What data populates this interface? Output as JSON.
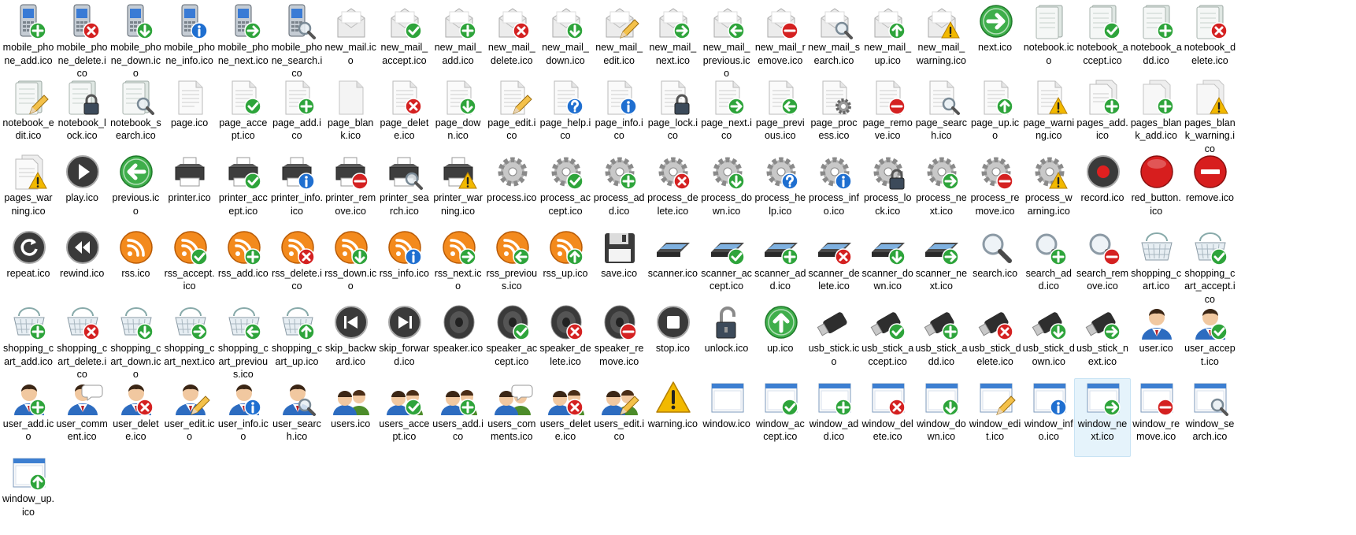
{
  "colors": {
    "accept": "#2ea43b",
    "add": "#2ea43b",
    "delete": "#d42121",
    "remove": "#d42121",
    "down": "#2ea43b",
    "up": "#2ea43b",
    "next": "#2ea43b",
    "previous": "#2ea43b",
    "info": "#1f6fd0",
    "help": "#1f6fd0",
    "warning": "#f2b900",
    "selection": "#e5f3fb"
  },
  "selected_file": "window_next.ico",
  "files": [
    {
      "name": "mobile_phone_add.ico",
      "icon": "mobile-phone-icon",
      "badge": "add"
    },
    {
      "name": "mobile_phone_delete.ico",
      "icon": "mobile-phone-icon",
      "badge": "delete"
    },
    {
      "name": "mobile_phone_down.ico",
      "icon": "mobile-phone-icon",
      "badge": "down"
    },
    {
      "name": "mobile_phone_info.ico",
      "icon": "mobile-phone-icon",
      "badge": "info"
    },
    {
      "name": "mobile_phone_next.ico",
      "icon": "mobile-phone-icon",
      "badge": "next"
    },
    {
      "name": "mobile_phone_search.ico",
      "icon": "mobile-phone-icon",
      "badge": "search"
    },
    {
      "name": "new_mail.ico",
      "icon": "mail-icon",
      "badge": ""
    },
    {
      "name": "new_mail_accept.ico",
      "icon": "mail-icon",
      "badge": "accept"
    },
    {
      "name": "new_mail_add.ico",
      "icon": "mail-icon",
      "badge": "add"
    },
    {
      "name": "new_mail_delete.ico",
      "icon": "mail-icon",
      "badge": "delete"
    },
    {
      "name": "new_mail_down.ico",
      "icon": "mail-icon",
      "badge": "down"
    },
    {
      "name": "new_mail_edit.ico",
      "icon": "mail-icon",
      "badge": "edit"
    },
    {
      "name": "new_mail_next.ico",
      "icon": "mail-icon",
      "badge": "next"
    },
    {
      "name": "new_mail_previous.ico",
      "icon": "mail-icon",
      "badge": "previous"
    },
    {
      "name": "new_mail_remove.ico",
      "icon": "mail-icon",
      "badge": "remove"
    },
    {
      "name": "new_mail_search.ico",
      "icon": "mail-icon",
      "badge": "search"
    },
    {
      "name": "new_mail_up.ico",
      "icon": "mail-icon",
      "badge": "up"
    },
    {
      "name": "new_mail_warning.ico",
      "icon": "mail-icon",
      "badge": "warning"
    },
    {
      "name": "next.ico",
      "icon": "next-arrow-icon",
      "badge": ""
    },
    {
      "name": "notebook.ico",
      "icon": "notebook-icon",
      "badge": ""
    },
    {
      "name": "notebook_accept.ico",
      "icon": "notebook-icon",
      "badge": "accept"
    },
    {
      "name": "notebook_add.ico",
      "icon": "notebook-icon",
      "badge": "add"
    },
    {
      "name": "notebook_delete.ico",
      "icon": "notebook-icon",
      "badge": "delete"
    },
    {
      "name": "notebook_edit.ico",
      "icon": "notebook-icon",
      "badge": "edit"
    },
    {
      "name": "notebook_lock.ico",
      "icon": "notebook-icon",
      "badge": "lock"
    },
    {
      "name": "notebook_search.ico",
      "icon": "notebook-icon",
      "badge": "search"
    },
    {
      "name": "page.ico",
      "icon": "page-icon",
      "badge": ""
    },
    {
      "name": "page_accept.ico",
      "icon": "page-icon",
      "badge": "accept"
    },
    {
      "name": "page_add.ico",
      "icon": "page-icon",
      "badge": "add"
    },
    {
      "name": "page_blank.ico",
      "icon": "blank-page-icon",
      "badge": ""
    },
    {
      "name": "page_delete.ico",
      "icon": "page-icon",
      "badge": "delete"
    },
    {
      "name": "page_down.ico",
      "icon": "page-icon",
      "badge": "down"
    },
    {
      "name": "page_edit.ico",
      "icon": "page-icon",
      "badge": "edit"
    },
    {
      "name": "page_help.ico",
      "icon": "page-icon",
      "badge": "help"
    },
    {
      "name": "page_info.ico",
      "icon": "page-icon",
      "badge": "info"
    },
    {
      "name": "page_lock.ico",
      "icon": "page-icon",
      "badge": "lock"
    },
    {
      "name": "page_next.ico",
      "icon": "page-icon",
      "badge": "next"
    },
    {
      "name": "page_previous.ico",
      "icon": "page-icon",
      "badge": "previous"
    },
    {
      "name": "page_process.ico",
      "icon": "page-icon",
      "badge": "gear"
    },
    {
      "name": "page_remove.ico",
      "icon": "page-icon",
      "badge": "remove"
    },
    {
      "name": "page_search.ico",
      "icon": "page-icon",
      "badge": "search"
    },
    {
      "name": "page_up.ico",
      "icon": "page-icon",
      "badge": "up"
    },
    {
      "name": "page_warning.ico",
      "icon": "page-icon",
      "badge": "warning"
    },
    {
      "name": "pages_add.ico",
      "icon": "pages-icon",
      "badge": "add"
    },
    {
      "name": "pages_blank_add.ico",
      "icon": "blank-pages-icon",
      "badge": "add"
    },
    {
      "name": "pages_blank_warning.ico",
      "icon": "blank-pages-icon",
      "badge": "warning"
    },
    {
      "name": "pages_warning.ico",
      "icon": "pages-icon",
      "badge": "warning"
    },
    {
      "name": "play.ico",
      "icon": "play-icon",
      "badge": ""
    },
    {
      "name": "previous.ico",
      "icon": "previous-arrow-icon",
      "badge": ""
    },
    {
      "name": "printer.ico",
      "icon": "printer-icon",
      "badge": ""
    },
    {
      "name": "printer_accept.ico",
      "icon": "printer-icon",
      "badge": "accept"
    },
    {
      "name": "printer_info.ico",
      "icon": "printer-icon",
      "badge": "info"
    },
    {
      "name": "printer_remove.ico",
      "icon": "printer-icon",
      "badge": "remove"
    },
    {
      "name": "printer_search.ico",
      "icon": "printer-icon",
      "badge": "search"
    },
    {
      "name": "printer_warning.ico",
      "icon": "printer-icon",
      "badge": "warning"
    },
    {
      "name": "process.ico",
      "icon": "gear-icon",
      "badge": ""
    },
    {
      "name": "process_accept.ico",
      "icon": "gear-icon",
      "badge": "accept"
    },
    {
      "name": "process_add.ico",
      "icon": "gear-icon",
      "badge": "add"
    },
    {
      "name": "process_delete.ico",
      "icon": "gear-icon",
      "badge": "delete"
    },
    {
      "name": "process_down.ico",
      "icon": "gear-icon",
      "badge": "down"
    },
    {
      "name": "process_help.ico",
      "icon": "gear-icon",
      "badge": "help"
    },
    {
      "name": "process_info.ico",
      "icon": "gear-icon",
      "badge": "info"
    },
    {
      "name": "process_lock.ico",
      "icon": "gear-icon",
      "badge": "lock"
    },
    {
      "name": "process_next.ico",
      "icon": "gear-icon",
      "badge": "next"
    },
    {
      "name": "process_remove.ico",
      "icon": "gear-icon",
      "badge": "remove"
    },
    {
      "name": "process_warning.ico",
      "icon": "gear-icon",
      "badge": "warning"
    },
    {
      "name": "record.ico",
      "icon": "record-icon",
      "badge": ""
    },
    {
      "name": "red_button.ico",
      "icon": "red-button-icon",
      "badge": ""
    },
    {
      "name": "remove.ico",
      "icon": "remove-circle-icon",
      "badge": ""
    },
    {
      "name": "repeat.ico",
      "icon": "repeat-icon",
      "badge": ""
    },
    {
      "name": "rewind.ico",
      "icon": "rewind-icon",
      "badge": ""
    },
    {
      "name": "rss.ico",
      "icon": "rss-icon",
      "badge": ""
    },
    {
      "name": "rss_accept.ico",
      "icon": "rss-icon",
      "badge": "accept"
    },
    {
      "name": "rss_add.ico",
      "icon": "rss-icon",
      "badge": "add"
    },
    {
      "name": "rss_delete.ico",
      "icon": "rss-icon",
      "badge": "delete"
    },
    {
      "name": "rss_down.ico",
      "icon": "rss-icon",
      "badge": "down"
    },
    {
      "name": "rss_info.ico",
      "icon": "rss-icon",
      "badge": "info"
    },
    {
      "name": "rss_next.ico",
      "icon": "rss-icon",
      "badge": "next"
    },
    {
      "name": "rss_previous.ico",
      "icon": "rss-icon",
      "badge": "previous"
    },
    {
      "name": "rss_up.ico",
      "icon": "rss-icon",
      "badge": "up"
    },
    {
      "name": "save.ico",
      "icon": "floppy-disk-icon",
      "badge": ""
    },
    {
      "name": "scanner.ico",
      "icon": "scanner-icon",
      "badge": ""
    },
    {
      "name": "scanner_accept.ico",
      "icon": "scanner-icon",
      "badge": "accept"
    },
    {
      "name": "scanner_add.ico",
      "icon": "scanner-icon",
      "badge": "add"
    },
    {
      "name": "scanner_delete.ico",
      "icon": "scanner-icon",
      "badge": "delete"
    },
    {
      "name": "scanner_down.ico",
      "icon": "scanner-icon",
      "badge": "down"
    },
    {
      "name": "scanner_next.ico",
      "icon": "scanner-icon",
      "badge": "next"
    },
    {
      "name": "search.ico",
      "icon": "magnifier-icon",
      "badge": ""
    },
    {
      "name": "search_add.ico",
      "icon": "magnifier-icon",
      "badge": "plus"
    },
    {
      "name": "search_remove.ico",
      "icon": "magnifier-icon",
      "badge": "minus"
    },
    {
      "name": "shopping_cart.ico",
      "icon": "shopping-basket-icon",
      "badge": ""
    },
    {
      "name": "shopping_cart_accept.ico",
      "icon": "shopping-basket-icon",
      "badge": "accept"
    },
    {
      "name": "shopping_cart_add.ico",
      "icon": "shopping-basket-icon",
      "badge": "add"
    },
    {
      "name": "shopping_cart_delete.ico",
      "icon": "shopping-basket-icon",
      "badge": "delete"
    },
    {
      "name": "shopping_cart_down.ico",
      "icon": "shopping-basket-icon",
      "badge": "down"
    },
    {
      "name": "shopping_cart_next.ico",
      "icon": "shopping-basket-icon",
      "badge": "next"
    },
    {
      "name": "shopping_cart_previous.ico",
      "icon": "shopping-basket-icon",
      "badge": "previous"
    },
    {
      "name": "shopping_cart_up.ico",
      "icon": "shopping-basket-icon",
      "badge": "up"
    },
    {
      "name": "skip_backward.ico",
      "icon": "skip-backward-icon",
      "badge": ""
    },
    {
      "name": "skip_forward.ico",
      "icon": "skip-forward-icon",
      "badge": ""
    },
    {
      "name": "speaker.ico",
      "icon": "speaker-icon",
      "badge": ""
    },
    {
      "name": "speaker_accept.ico",
      "icon": "speaker-icon",
      "badge": "accept"
    },
    {
      "name": "speaker_delete.ico",
      "icon": "speaker-icon",
      "badge": "delete"
    },
    {
      "name": "speaker_remove.ico",
      "icon": "speaker-icon",
      "badge": "remove"
    },
    {
      "name": "stop.ico",
      "icon": "stop-icon",
      "badge": ""
    },
    {
      "name": "unlock.ico",
      "icon": "padlock-open-icon",
      "badge": ""
    },
    {
      "name": "up.ico",
      "icon": "up-arrow-icon",
      "badge": ""
    },
    {
      "name": "usb_stick.ico",
      "icon": "usb-stick-icon",
      "badge": ""
    },
    {
      "name": "usb_stick_accept.ico",
      "icon": "usb-stick-icon",
      "badge": "accept"
    },
    {
      "name": "usb_stick_add.ico",
      "icon": "usb-stick-icon",
      "badge": "add"
    },
    {
      "name": "usb_stick_delete.ico",
      "icon": "usb-stick-icon",
      "badge": "delete"
    },
    {
      "name": "usb_stick_down.ico",
      "icon": "usb-stick-icon",
      "badge": "down"
    },
    {
      "name": "usb_stick_next.ico",
      "icon": "usb-stick-icon",
      "badge": "next"
    },
    {
      "name": "user.ico",
      "icon": "user-icon",
      "badge": ""
    },
    {
      "name": "user_accept.ico",
      "icon": "user-icon",
      "badge": "accept"
    },
    {
      "name": "user_add.ico",
      "icon": "user-icon",
      "badge": "add"
    },
    {
      "name": "user_comment.ico",
      "icon": "user-icon",
      "badge": "comment"
    },
    {
      "name": "user_delete.ico",
      "icon": "user-icon",
      "badge": "delete"
    },
    {
      "name": "user_edit.ico",
      "icon": "user-icon",
      "badge": "edit"
    },
    {
      "name": "user_info.ico",
      "icon": "user-icon",
      "badge": "info"
    },
    {
      "name": "user_search.ico",
      "icon": "user-icon",
      "badge": "search"
    },
    {
      "name": "users.ico",
      "icon": "users-icon",
      "badge": ""
    },
    {
      "name": "users_accept.ico",
      "icon": "users-icon",
      "badge": "accept"
    },
    {
      "name": "users_add.ico",
      "icon": "users-icon",
      "badge": "add"
    },
    {
      "name": "users_comments.ico",
      "icon": "users-icon",
      "badge": "comment"
    },
    {
      "name": "users_delete.ico",
      "icon": "users-icon",
      "badge": "delete"
    },
    {
      "name": "users_edit.ico",
      "icon": "users-icon",
      "badge": "edit"
    },
    {
      "name": "warning.ico",
      "icon": "warning-triangle-icon",
      "badge": ""
    },
    {
      "name": "window.ico",
      "icon": "window-icon",
      "badge": ""
    },
    {
      "name": "window_accept.ico",
      "icon": "window-icon",
      "badge": "accept"
    },
    {
      "name": "window_add.ico",
      "icon": "window-icon",
      "badge": "add"
    },
    {
      "name": "window_delete.ico",
      "icon": "window-icon",
      "badge": "delete"
    },
    {
      "name": "window_down.ico",
      "icon": "window-icon",
      "badge": "down"
    },
    {
      "name": "window_edit.ico",
      "icon": "window-icon",
      "badge": "edit"
    },
    {
      "name": "window_info.ico",
      "icon": "window-icon",
      "badge": "info"
    },
    {
      "name": "window_next.ico",
      "icon": "window-icon",
      "badge": "next"
    },
    {
      "name": "window_remove.ico",
      "icon": "window-icon",
      "badge": "remove"
    },
    {
      "name": "window_search.ico",
      "icon": "window-icon",
      "badge": "search"
    },
    {
      "name": "window_up.ico",
      "icon": "window-icon",
      "badge": "up"
    }
  ]
}
